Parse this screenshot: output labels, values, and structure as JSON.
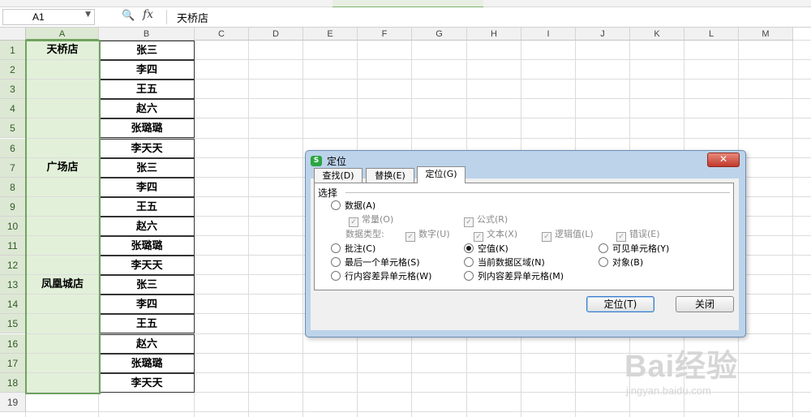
{
  "formula_bar": {
    "name_box": "A1",
    "content": "天桥店"
  },
  "columns": [
    "A",
    "B",
    "C",
    "D",
    "E",
    "F",
    "G",
    "H",
    "I",
    "J",
    "K",
    "L",
    "M"
  ],
  "rows": [
    "1",
    "2",
    "3",
    "4",
    "5",
    "6",
    "7",
    "8",
    "9",
    "10",
    "11",
    "12",
    "13",
    "14",
    "15",
    "16",
    "17",
    "18",
    "19"
  ],
  "column_a_values": {
    "r1": "天桥店",
    "r7": "广场店",
    "r13": "凤凰城店"
  },
  "column_b_values": [
    "张三",
    "李四",
    "王五",
    "赵六",
    "张璐璐",
    "李天天",
    "张三",
    "李四",
    "王五",
    "赵六",
    "张璐璐",
    "李天天",
    "张三",
    "李四",
    "王五",
    "赵六",
    "张璐璐",
    "李天天"
  ],
  "dialog": {
    "title": "定位",
    "tabs": [
      "查找(D)",
      "替换(E)",
      "定位(G)"
    ],
    "active_tab": "定位(G)",
    "group_label": "选择",
    "options": {
      "data": "数据(A)",
      "constants": "常量(O)",
      "formula": "公式(R)",
      "data_type_label": "数据类型:",
      "numbers": "数字(U)",
      "text": "文本(X)",
      "logicals": "逻辑值(L)",
      "errors": "错误(E)",
      "comments": "批注(C)",
      "blanks": "空值(K)",
      "visible_cells": "可见单元格(Y)",
      "last_cell": "最后一个单元格(S)",
      "current_region": "当前数据区域(N)",
      "objects": "对象(B)",
      "row_differences": "行内容差异单元格(W)",
      "column_differences": "列内容差异单元格(M)"
    },
    "selected_option": "空值(K)",
    "ok_label": "定位(T)",
    "close_label": "关闭"
  },
  "watermark": {
    "brand": "Bai经验",
    "url": "jingyan.baidu.com"
  },
  "colors": {
    "selection_green": "#6fa35d",
    "selection_fill": "#e2f0d9",
    "dialog_frame": "#bcd3ea",
    "close_red": "#c0392b"
  }
}
